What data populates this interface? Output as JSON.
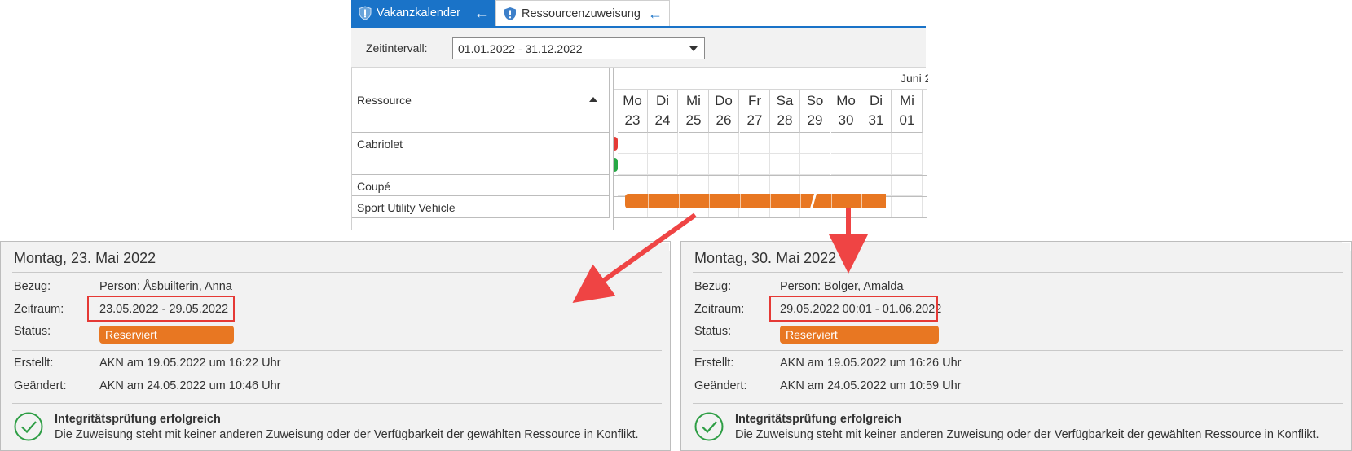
{
  "tabs": [
    {
      "label": "Vakanzkalender",
      "icon": "shield-icon",
      "back_icon": "back-arrow-icon"
    },
    {
      "label": "Ressourcenzuweisung",
      "icon": "shield-icon",
      "back_icon": "back-arrow-icon"
    }
  ],
  "toolbar": {
    "interval_label": "Zeitintervall:",
    "interval_value": "01.01.2022 - 31.12.2022"
  },
  "grid": {
    "resource_header": "Ressource",
    "month_label": "Juni 2",
    "days": [
      {
        "wd": "Mo",
        "dn": "23"
      },
      {
        "wd": "Di",
        "dn": "24"
      },
      {
        "wd": "Mi",
        "dn": "25"
      },
      {
        "wd": "Do",
        "dn": "26"
      },
      {
        "wd": "Fr",
        "dn": "27"
      },
      {
        "wd": "Sa",
        "dn": "28"
      },
      {
        "wd": "So",
        "dn": "29"
      },
      {
        "wd": "Mo",
        "dn": "30"
      },
      {
        "wd": "Di",
        "dn": "31"
      },
      {
        "wd": "Mi",
        "dn": "01"
      }
    ],
    "resources": [
      "Cabriolet",
      "Coupé",
      "Sport Utility Vehicle"
    ]
  },
  "colors": {
    "accent": "#1a73c8",
    "reserved": "#e87722",
    "conflict_red": "#e53935",
    "free_green": "#27a845",
    "ok_green": "#2e9e45"
  },
  "panels": [
    {
      "title": "Montag, 23. Mai 2022",
      "bezug_label": "Bezug:",
      "bezug_value": "Person: Åsbuilterin, Anna",
      "zeitraum_label": "Zeitraum:",
      "zeitraum_value": "23.05.2022 - 29.05.2022",
      "status_label": "Status:",
      "status_value": "Reserviert",
      "erstellt_label": "Erstellt:",
      "erstellt_value": "AKN am 19.05.2022 um 16:22 Uhr",
      "geaendert_label": "Geändert:",
      "geaendert_value": "AKN am 24.05.2022 um 10:46 Uhr",
      "check_title": "Integritätsprüfung erfolgreich",
      "check_text": "Die Zuweisung steht mit keiner anderen Zuweisung oder der Verfügbarkeit der gewählten Ressource in Konflikt."
    },
    {
      "title": "Montag, 30. Mai 2022",
      "bezug_label": "Bezug:",
      "bezug_value": "Person: Bolger, Amalda",
      "zeitraum_label": "Zeitraum:",
      "zeitraum_value": "29.05.2022 00:01 - 01.06.2022",
      "status_label": "Status:",
      "status_value": "Reserviert",
      "erstellt_label": "Erstellt:",
      "erstellt_value": "AKN am 19.05.2022 um 16:26 Uhr",
      "geaendert_label": "Geändert:",
      "geaendert_value": "AKN am 24.05.2022 um 10:59 Uhr",
      "check_title": "Integritätsprüfung erfolgreich",
      "check_text": "Die Zuweisung steht mit keiner anderen Zuweisung oder der Verfügbarkeit der gewählten Ressource in Konflikt."
    }
  ]
}
